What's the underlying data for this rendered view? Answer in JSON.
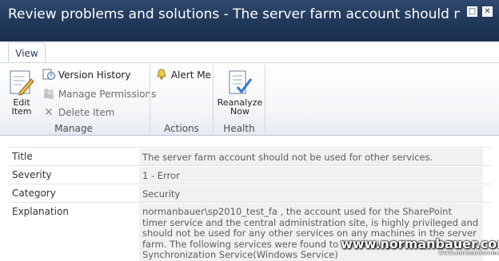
{
  "window": {
    "title": "Review problems and solutions - The server farm account should not be use...",
    "maximize_glyph": "□",
    "close_glyph": "✕"
  },
  "ribbon": {
    "tab_label": "View",
    "groups": {
      "manage": {
        "label": "Manage",
        "edit_item": "Edit Item",
        "version_history": "Version History",
        "manage_permissions": "Manage Permissions",
        "delete_item": "Delete Item"
      },
      "actions": {
        "label": "Actions",
        "alert_me": "Alert Me"
      },
      "health": {
        "label": "Health",
        "reanalyze_now": "Reanalyze Now"
      }
    }
  },
  "fields": [
    {
      "label": "Title",
      "value": "The server farm account should not be used for other services."
    },
    {
      "label": "Severity",
      "value": "1 - Error"
    },
    {
      "label": "Category",
      "value": "Security"
    },
    {
      "label": "Explanation",
      "lines": [
        "normanbauer\\sp2010_test_fa , the account used for the SharePoint",
        "timer service and the central administration site, is highly privileged and",
        "should not be used for any other services on any machines in the server",
        "farm.  The following services were found to be running as Security Token",
        "Synchronization Service(Windows Service)"
      ]
    }
  ],
  "watermark": {
    "main": "www.normanbauer.com",
    "small": "www.normanbauer.com"
  }
}
